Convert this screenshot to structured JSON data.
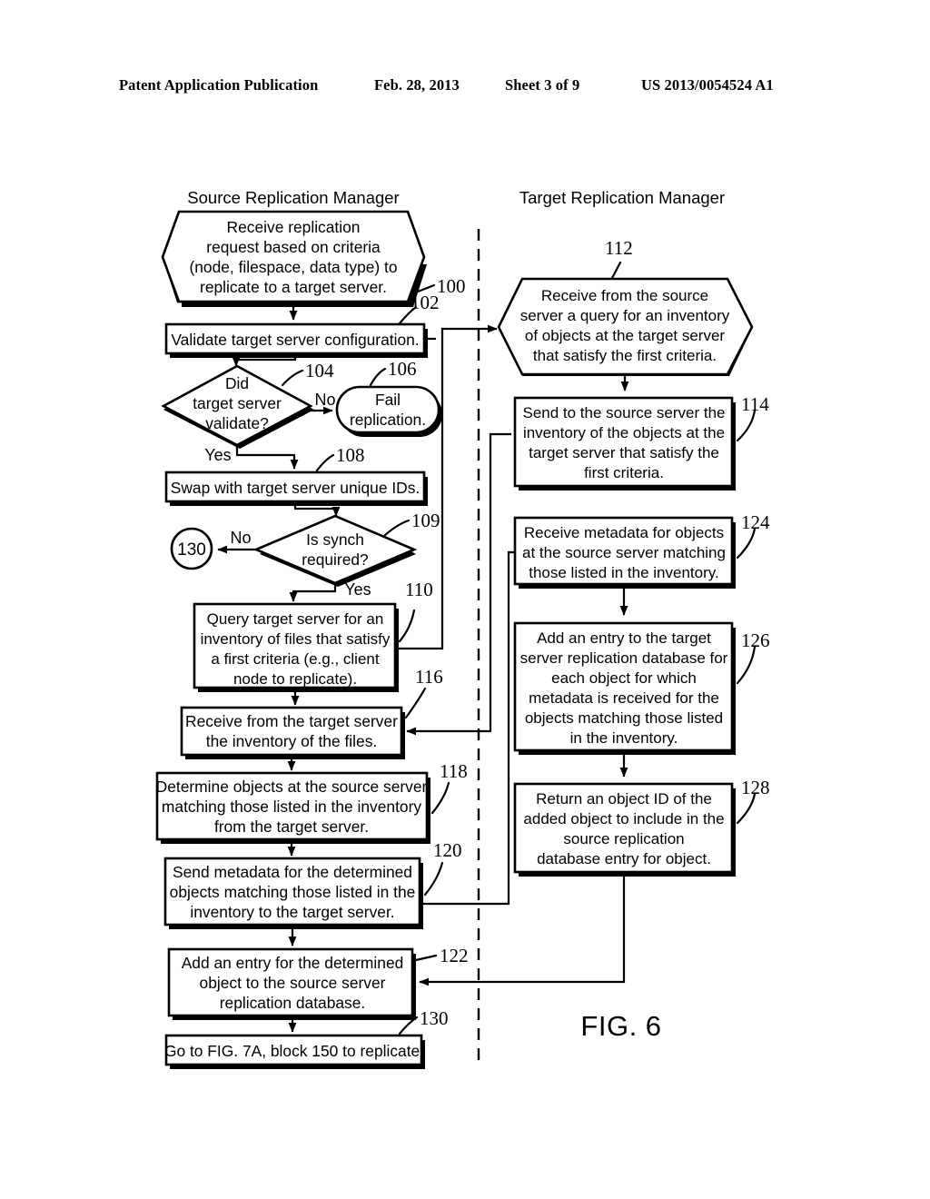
{
  "header": {
    "publication": "Patent Application Publication",
    "date": "Feb. 28, 2013",
    "sheet": "Sheet 3 of 9",
    "patent_number": "US 2013/0054524 A1"
  },
  "figure": {
    "label": "FIG. 6",
    "lanes": {
      "source": "Source Replication Manager",
      "target": "Target Replication Manager"
    },
    "edge_labels": {
      "no_104": "No",
      "yes_104": "Yes",
      "no_109": "No",
      "yes_109": "Yes"
    },
    "connector_circle": {
      "ref": "130"
    },
    "nodes": {
      "n100": {
        "ref": "100",
        "shape": "hexagon",
        "lines": [
          "Receive replication",
          "request based on criteria",
          "(node, filespace, data type) to",
          "replicate to a target server."
        ]
      },
      "n102": {
        "ref": "102",
        "shape": "rect",
        "lines": [
          "Validate target server configuration."
        ]
      },
      "n104": {
        "ref": "104",
        "shape": "diamond",
        "lines": [
          "Did",
          "target server",
          "validate?"
        ]
      },
      "n106": {
        "ref": "106",
        "shape": "pill",
        "lines": [
          "Fail",
          "replication."
        ]
      },
      "n108": {
        "ref": "108",
        "shape": "rect",
        "lines": [
          "Swap with target server unique IDs."
        ]
      },
      "n109": {
        "ref": "109",
        "shape": "diamond",
        "lines": [
          "Is synch",
          "required?"
        ]
      },
      "n110": {
        "ref": "110",
        "shape": "rect",
        "lines": [
          "Query target server for an",
          "inventory of files that satisfy",
          "a first criteria (e.g., client",
          "node to replicate)."
        ]
      },
      "n116": {
        "ref": "116",
        "shape": "rect",
        "lines": [
          "Receive from the target server",
          "the inventory of the files."
        ]
      },
      "n118": {
        "ref": "118",
        "shape": "rect",
        "lines": [
          "Determine objects at the source server",
          "matching those listed in the inventory",
          "from the target server."
        ]
      },
      "n120": {
        "ref": "120",
        "shape": "rect",
        "lines": [
          "Send metadata for the determined",
          "objects matching those listed in the",
          "inventory to the target server."
        ]
      },
      "n122": {
        "ref": "122",
        "shape": "rect",
        "lines": [
          "Add an entry for the determined",
          "object to the source server",
          "replication database."
        ]
      },
      "n130": {
        "ref": "130",
        "shape": "rect",
        "lines": [
          "Go to FIG. 7A, block 150 to replicate."
        ]
      },
      "n112": {
        "ref": "112",
        "shape": "hexagon",
        "lines": [
          "Receive from the source",
          "server a query for an inventory",
          "of objects at the target server",
          "that satisfy the first criteria."
        ]
      },
      "n114": {
        "ref": "114",
        "shape": "rect",
        "lines": [
          "Send to the source server the",
          "inventory of the objects at the",
          "target server that satisfy the",
          "first criteria."
        ]
      },
      "n124": {
        "ref": "124",
        "shape": "rect",
        "lines": [
          "Receive metadata for objects",
          "at the source server matching",
          "those listed in the inventory."
        ]
      },
      "n126": {
        "ref": "126",
        "shape": "rect",
        "lines": [
          "Add an entry to the target",
          "server replication database for",
          "each object for which",
          "metadata is received for the",
          "objects matching those listed",
          "in the inventory."
        ]
      },
      "n128": {
        "ref": "128",
        "shape": "rect",
        "lines": [
          "Return an object ID of the",
          "added object to include in the",
          "source replication",
          "database entry for object."
        ]
      }
    }
  }
}
